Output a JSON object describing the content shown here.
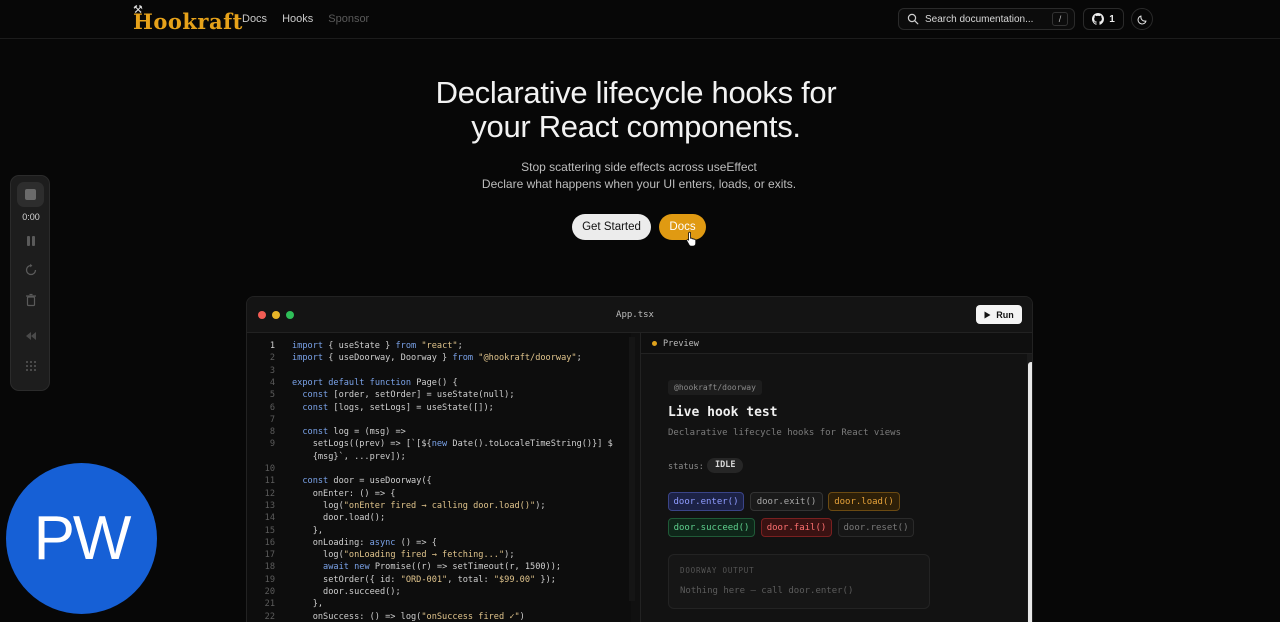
{
  "nav": {
    "logo_text": "Hookraft",
    "links": [
      "Docs",
      "Hooks",
      "Sponsor"
    ],
    "search_placeholder": "Search documentation...",
    "search_shortcut": "/",
    "github_count": "1"
  },
  "hero": {
    "title_line1": "Declarative lifecycle hooks for",
    "title_line2": "your React components.",
    "subtitle_line1": "Stop scattering side effects across useEffect",
    "subtitle_line2": "Declare what happens when your UI enters, loads, or exits.",
    "get_started_label": "Get Started",
    "docs_label": "Docs"
  },
  "recorder": {
    "time": "0:00"
  },
  "badge": {
    "text": "PW"
  },
  "editor": {
    "filename": "App.tsx",
    "run_label": "Run",
    "line_numbers": [
      "1",
      "2",
      "3",
      "4",
      "5",
      "6",
      "7",
      "8",
      "9",
      "",
      "10",
      "11",
      "12",
      "13",
      "14",
      "15",
      "16",
      "17",
      "18",
      "19",
      "20",
      "21",
      "22"
    ],
    "lines": [
      "import { useState } from \"react\";",
      "import { useDoorway, Doorway } from \"@hookraft/doorway\";",
      "",
      "export default function Page() {",
      "  const [order, setOrder] = useState(null);",
      "  const [logs, setLogs] = useState([]);",
      "",
      "  const log = (msg) =>",
      "    setLogs((prev) => [`[${new Date().toLocaleTimeString()}] $",
      "    {msg}`, ...prev]);",
      "",
      "  const door = useDoorway({",
      "    onEnter: () => {",
      "      log(\"onEnter fired → calling door.load()\");",
      "      door.load();",
      "    },",
      "    onLoading: async () => {",
      "      log(\"onLoading fired → fetching...\");",
      "      await new Promise((r) => setTimeout(r, 1500));",
      "      setOrder({ id: \"ORD-001\", total: \"$99.00\" });",
      "      door.succeed();",
      "    },",
      "    onSuccess: () => log(\"onSuccess fired ✓\")"
    ]
  },
  "preview": {
    "label": "Preview",
    "tag": "@hookraft/doorway",
    "title": "Live hook test",
    "subtitle": "Declarative lifecycle hooks for React views",
    "status_label": "status:",
    "status_value": "IDLE",
    "buttons": [
      {
        "label": "door.enter()",
        "color": "#8f9cff",
        "bg": "#1c2246",
        "border": "#3a4488"
      },
      {
        "label": "door.exit()",
        "color": "#a8a8a8",
        "bg": "#1a1a1a",
        "border": "#333333"
      },
      {
        "label": "door.load()",
        "color": "#e6a23a",
        "bg": "#2d1f08",
        "border": "#6b4a12"
      },
      {
        "label": "door.succeed()",
        "color": "#5fd08e",
        "bg": "#0e2619",
        "border": "#1f5a37"
      },
      {
        "label": "door.fail()",
        "color": "#ff7070",
        "bg": "#3a1212",
        "border": "#7a2020"
      },
      {
        "label": "door.reset()",
        "color": "#7a7a7a",
        "bg": "#161616",
        "border": "#2a2a2a"
      }
    ],
    "output_title": "DOORWAY OUTPUT",
    "output_empty": "Nothing here — call door.enter()"
  },
  "colors": {
    "accent": "#e09a12",
    "background": "#070707"
  }
}
